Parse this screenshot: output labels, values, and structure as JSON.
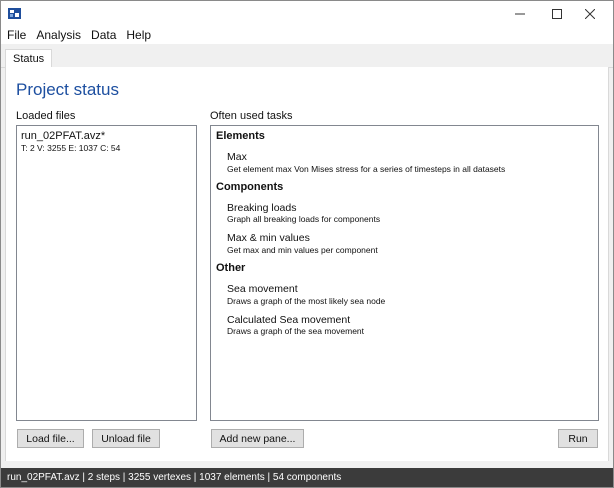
{
  "menubar": {
    "items": [
      "File",
      "Analysis",
      "Data",
      "Help"
    ]
  },
  "tabs": [
    "Status"
  ],
  "page": {
    "title": "Project status"
  },
  "loaded_files": {
    "label": "Loaded files",
    "files": [
      {
        "name": "run_02PFAT.avz*",
        "stats": "T: 2 V: 3255 E: 1037 C: 54"
      }
    ]
  },
  "tasks": {
    "label": "Often used tasks",
    "groups": [
      {
        "title": "Elements",
        "items": [
          {
            "title": "Max",
            "desc": "Get element max Von Mises stress for a series of timesteps in all datasets"
          }
        ]
      },
      {
        "title": "Components",
        "items": [
          {
            "title": "Breaking loads",
            "desc": "Graph all breaking loads for components"
          },
          {
            "title": "Max & min values",
            "desc": "Get max and min values per component"
          }
        ]
      },
      {
        "title": "Other",
        "items": [
          {
            "title": "Sea movement",
            "desc": "Draws a graph of the most likely sea node"
          },
          {
            "title": "Calculated Sea movement",
            "desc": "Draws a graph of the sea movement"
          }
        ]
      }
    ]
  },
  "buttons": {
    "load_file": "Load file...",
    "unload_file": "Unload file",
    "add_pane": "Add new pane...",
    "run": "Run"
  },
  "statusbar": {
    "text": "run_02PFAT.avz | 2 steps | 3255 vertexes | 1037 elements | 54 components"
  },
  "colors": {
    "title_blue": "#1d4fa0",
    "statusbar_bg": "#3b3b3b",
    "app_icon": "#1f4e9c"
  },
  "icons": {
    "app": "app-logo-icon",
    "minimize": "minimize-icon",
    "maximize": "maximize-icon",
    "close": "close-icon"
  }
}
